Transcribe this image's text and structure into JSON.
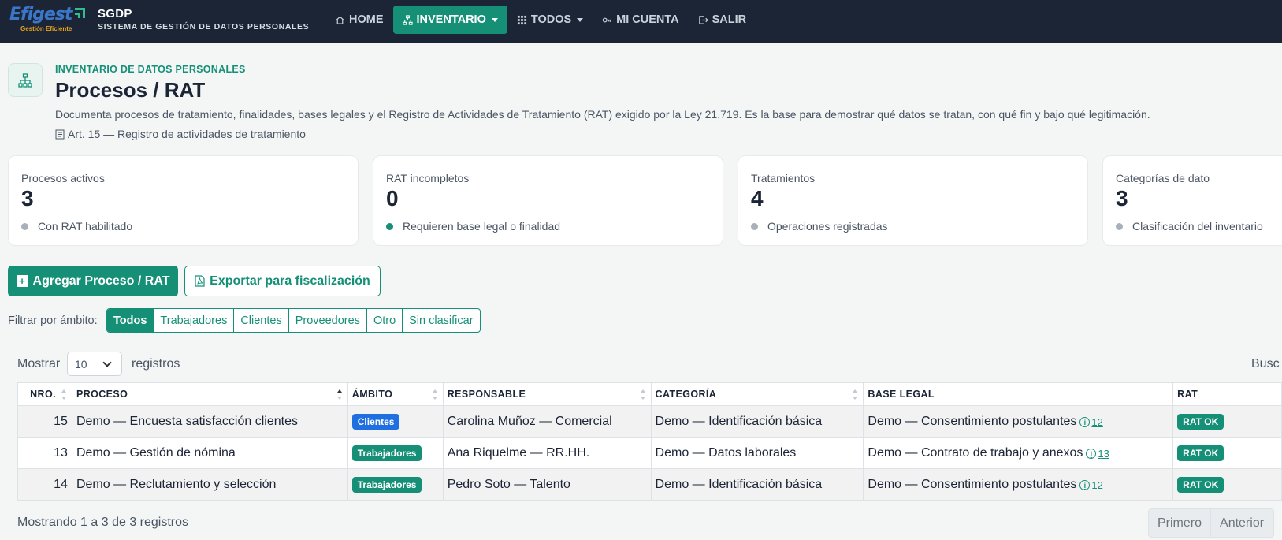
{
  "brand": {
    "logo_text": "Efigest",
    "logo_tagline": "Gestión Eficiente",
    "title": "SGDP",
    "subtitle": "SISTEMA DE GESTIÓN DE DATOS PERSONALES"
  },
  "nav": {
    "home": "HOME",
    "inventario": "INVENTARIO",
    "todos": "TODOS",
    "cuenta": "MI CUENTA",
    "salir": "SALIR"
  },
  "header": {
    "eyebrow": "INVENTARIO DE DATOS PERSONALES",
    "title": "Procesos / RAT",
    "description": "Documenta procesos de tratamiento, finalidades, bases legales y el Registro de Actividades de Tratamiento (RAT) exigido por la Ley 21.719. Es la base para demostrar qué datos se tratan, con qué fin y bajo qué legitimación.",
    "reference": "Art. 15 — Registro de actividades de tratamiento"
  },
  "stats": [
    {
      "label": "Procesos activos",
      "value": "3",
      "note": "Con RAT habilitado"
    },
    {
      "label": "RAT incompletos",
      "value": "0",
      "note": "Requieren base legal o finalidad"
    },
    {
      "label": "Tratamientos",
      "value": "4",
      "note": "Operaciones registradas"
    },
    {
      "label": "Categorías de dato",
      "value": "3",
      "note": "Clasificación del inventario"
    }
  ],
  "actions": {
    "add": "Agregar Proceso / RAT",
    "export": "Exportar para fiscalización"
  },
  "filter": {
    "label": "Filtrar por ámbito:",
    "options": [
      "Todos",
      "Trabajadores",
      "Clientes",
      "Proveedores",
      "Otro",
      "Sin clasificar"
    ]
  },
  "table_controls": {
    "show_prefix": "Mostrar",
    "page_size": "10",
    "show_suffix": "registros",
    "search_label": "Busc"
  },
  "table": {
    "headers": [
      "NRO.",
      "PROCESO",
      "ÁMBITO",
      "RESPONSABLE",
      "CATEGORÍA",
      "BASE LEGAL",
      "RAT"
    ],
    "rows": [
      {
        "nro": "15",
        "proceso": "Demo — Encuesta satisfacción clientes",
        "ambito": "Clientes",
        "responsable": "Carolina Muñoz — Comercial",
        "categoria": "Demo — Identificación básica",
        "base_legal": "Demo — Consentimiento postulantes",
        "base_id": "12",
        "rat": "RAT OK"
      },
      {
        "nro": "13",
        "proceso": "Demo — Gestión de nómina",
        "ambito": "Trabajadores",
        "responsable": "Ana Riquelme — RR.HH.",
        "categoria": "Demo — Datos laborales",
        "base_legal": "Demo — Contrato de trabajo y anexos",
        "base_id": "13",
        "rat": "RAT OK"
      },
      {
        "nro": "14",
        "proceso": "Demo — Reclutamiento y selección",
        "ambito": "Trabajadores",
        "responsable": "Pedro Soto — Talento",
        "categoria": "Demo — Identificación básica",
        "base_legal": "Demo — Consentimiento postulantes",
        "base_id": "12",
        "rat": "RAT OK"
      }
    ]
  },
  "footer": {
    "info": "Mostrando 1 a 3 de 3 registros",
    "first": "Primero",
    "previous": "Anterior"
  },
  "colors": {
    "navbar": "#1b2535",
    "accent": "#159077",
    "badge_blue": "#1f6fe0"
  }
}
